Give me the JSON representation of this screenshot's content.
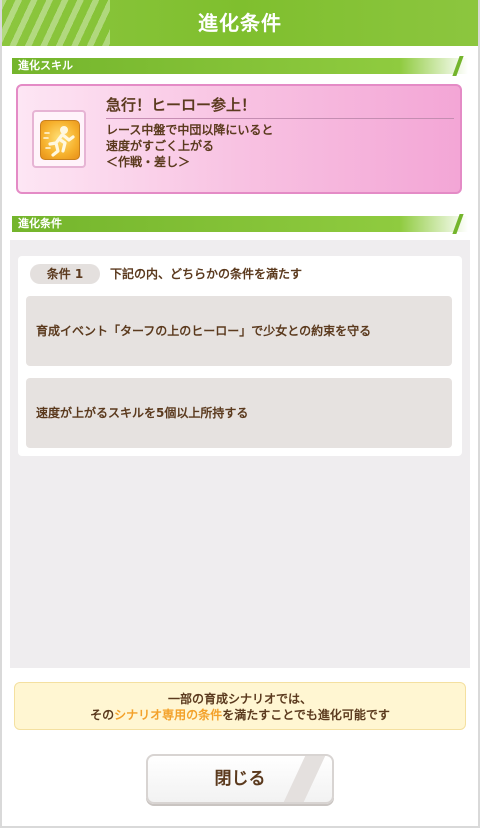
{
  "header": {
    "title": "進化条件"
  },
  "sections": {
    "skill_label": "進化スキル",
    "conditions_label": "進化条件"
  },
  "skill": {
    "icon": "running-figure-icon",
    "name": "急行！ヒーロー参上！",
    "desc_line1": "レース中盤で中団以降にいると",
    "desc_line2": "速度がすごく上がる",
    "desc_line3": "＜作戦・差し＞"
  },
  "conditions": {
    "badge": "条件 1",
    "title": "下記の内、どちらかの条件を満たす",
    "items": [
      "育成イベント「ターフの上のヒーロー」で少女との約束を守る",
      "速度が上がるスキルを5個以上所持する"
    ]
  },
  "notice": {
    "line1": "一部の育成シナリオでは、",
    "line2_pre": "その",
    "line2_highlight": "シナリオ専用の条件",
    "line2_post": "を満たすことでも進化可能です"
  },
  "buttons": {
    "close_label": "閉じる"
  },
  "colors": {
    "accent_green": "#8cc63f",
    "skill_pink": "#f3a6d6",
    "highlight_orange": "#f3a12a",
    "text_brown": "#5b3a1e"
  }
}
